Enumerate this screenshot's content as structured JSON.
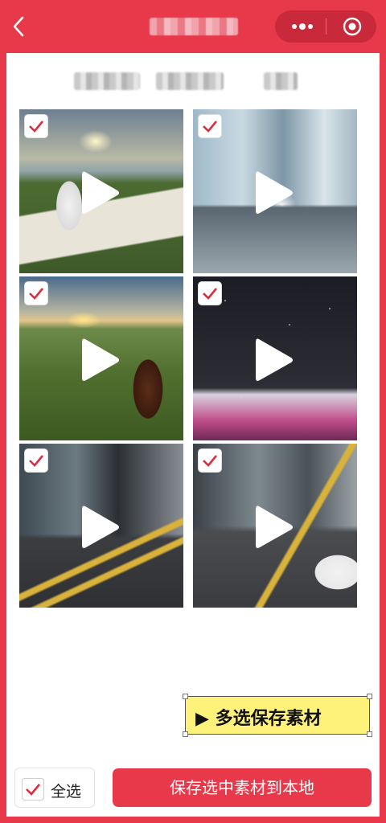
{
  "header": {
    "title": "",
    "back_icon": "chevron-left-icon",
    "more_icon": "more-dots-icon",
    "close_icon": "target-icon"
  },
  "tabs": [
    "",
    "",
    ""
  ],
  "media": [
    {
      "checked": true,
      "type": "video"
    },
    {
      "checked": true,
      "type": "video"
    },
    {
      "checked": true,
      "type": "video"
    },
    {
      "checked": true,
      "type": "video"
    },
    {
      "checked": true,
      "type": "video"
    },
    {
      "checked": true,
      "type": "video"
    }
  ],
  "floating_label": "▶ 多选保存素材",
  "footer": {
    "select_all_label": "全选",
    "save_button_label": "保存选中素材到本地"
  },
  "colors": {
    "brand_red": "#e8394a",
    "check_red": "#e02b3d",
    "highlight": "#fff27a"
  }
}
